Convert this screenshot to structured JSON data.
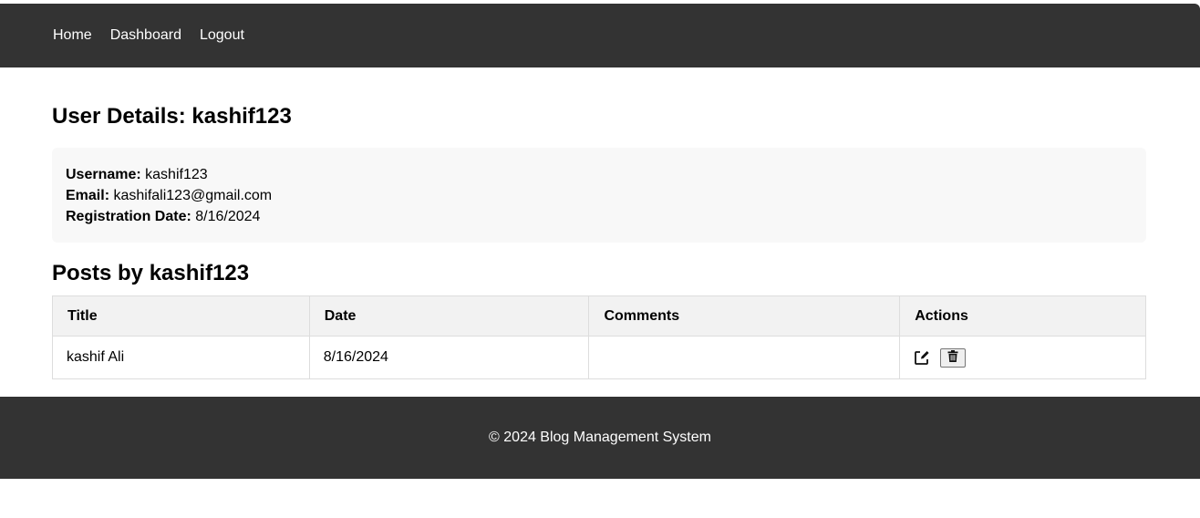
{
  "nav": {
    "links": [
      "Home",
      "Dashboard",
      "Logout"
    ]
  },
  "page": {
    "title": "User Details: kashif123"
  },
  "details": {
    "username_label": "Username:",
    "username": "kashif123",
    "email_label": "Email:",
    "email": "kashifali123@gmail.com",
    "registration_label": "Registration Date:",
    "registration_date": "8/16/2024"
  },
  "posts": {
    "title": "Posts by kashif123",
    "columns": [
      "Title",
      "Date",
      "Comments",
      "Actions"
    ],
    "rows": [
      {
        "title": "kashif Ali",
        "date": "8/16/2024",
        "comments": "",
        "actions": [
          "edit-icon",
          "trash-icon"
        ]
      }
    ]
  },
  "footer": {
    "text": "© 2024 Blog Management System"
  },
  "colors": {
    "nav_bg": "#333333",
    "footer_bg": "#333333",
    "card_bg": "#f8f8f8",
    "table_header_bg": "#f2f2f2",
    "border": "#dddddd"
  }
}
